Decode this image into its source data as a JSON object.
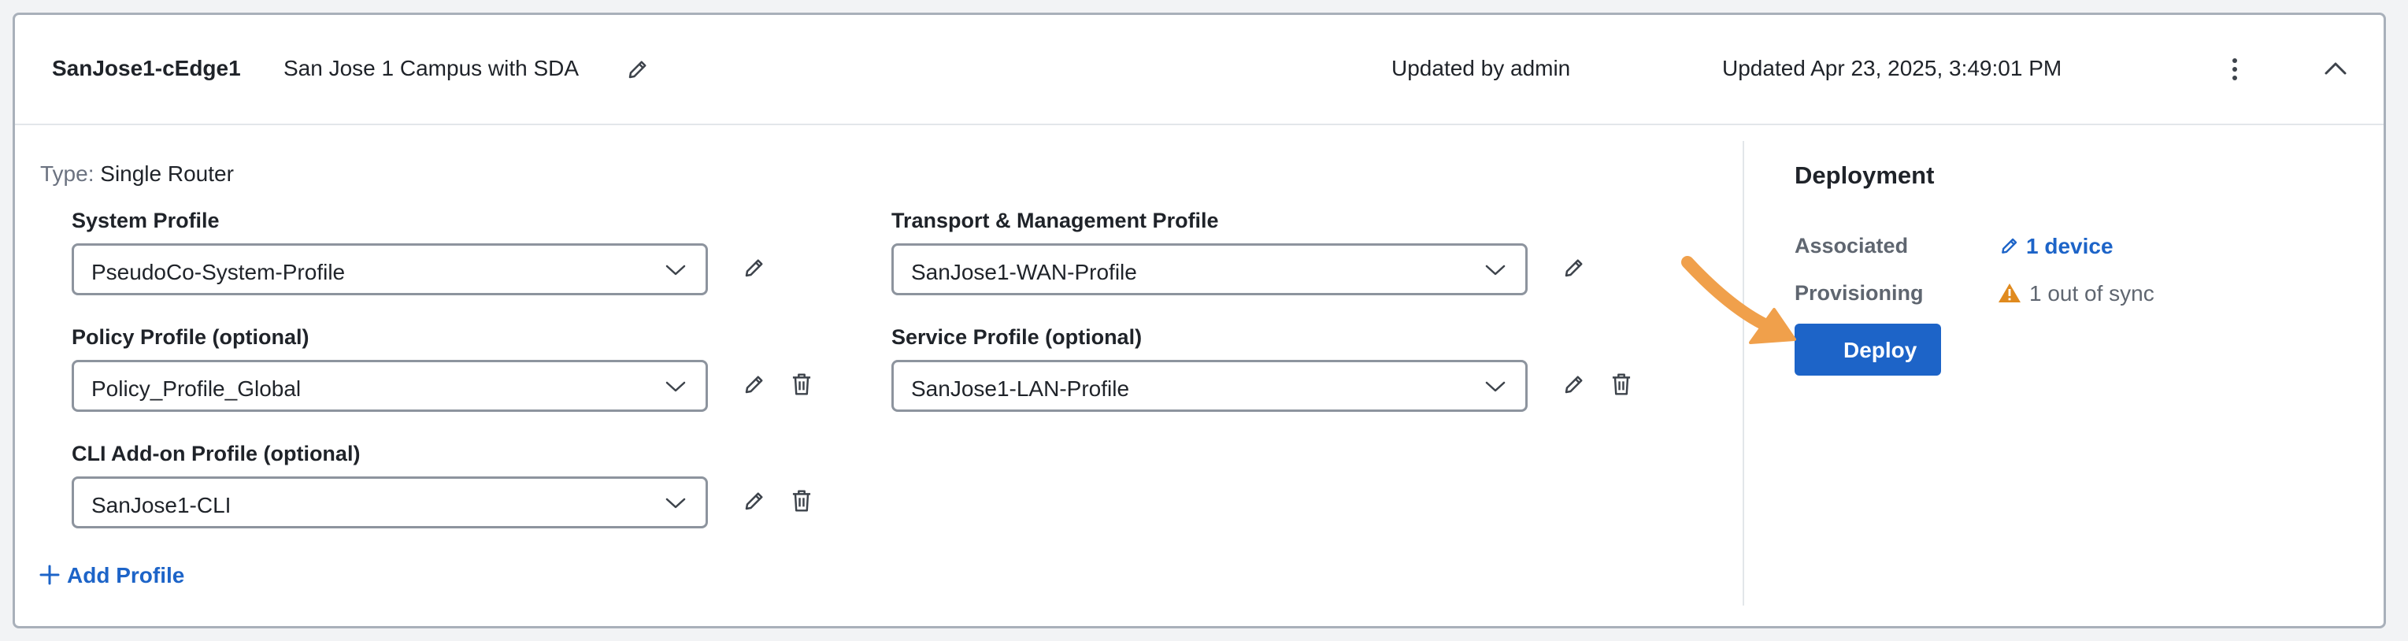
{
  "header": {
    "name": "SanJose1-cEdge1",
    "description": "San Jose 1 Campus with SDA",
    "updated_by": "Updated by admin",
    "updated_at": "Updated Apr 23, 2025, 3:49:01 PM"
  },
  "type": {
    "label": "Type:",
    "value": "Single Router"
  },
  "profiles": {
    "system": {
      "label": "System Profile",
      "value": "PseudoCo-System-Profile"
    },
    "transport": {
      "label": "Transport & Management Profile",
      "value": "SanJose1-WAN-Profile"
    },
    "policy": {
      "label": "Policy Profile (optional)",
      "value": "Policy_Profile_Global"
    },
    "service": {
      "label": "Service Profile (optional)",
      "value": "SanJose1-LAN-Profile"
    },
    "cli": {
      "label": "CLI Add-on Profile (optional)",
      "value": "SanJose1-CLI"
    }
  },
  "add_profile": "Add Profile",
  "deployment": {
    "title": "Deployment",
    "associated_label": "Associated",
    "associated_value": "1 device",
    "provisioning_label": "Provisioning",
    "provisioning_value": "1 out of sync",
    "deploy_label": "Deploy"
  },
  "colors": {
    "accent": "#1d64c8",
    "warning": "#e08a1e",
    "annotation_arrow": "#f0a04b"
  },
  "icons": [
    "pencil-icon",
    "kebab-menu-icon",
    "chevron-up-icon",
    "chevron-down-icon",
    "trash-icon",
    "plus-icon",
    "warning-icon"
  ]
}
